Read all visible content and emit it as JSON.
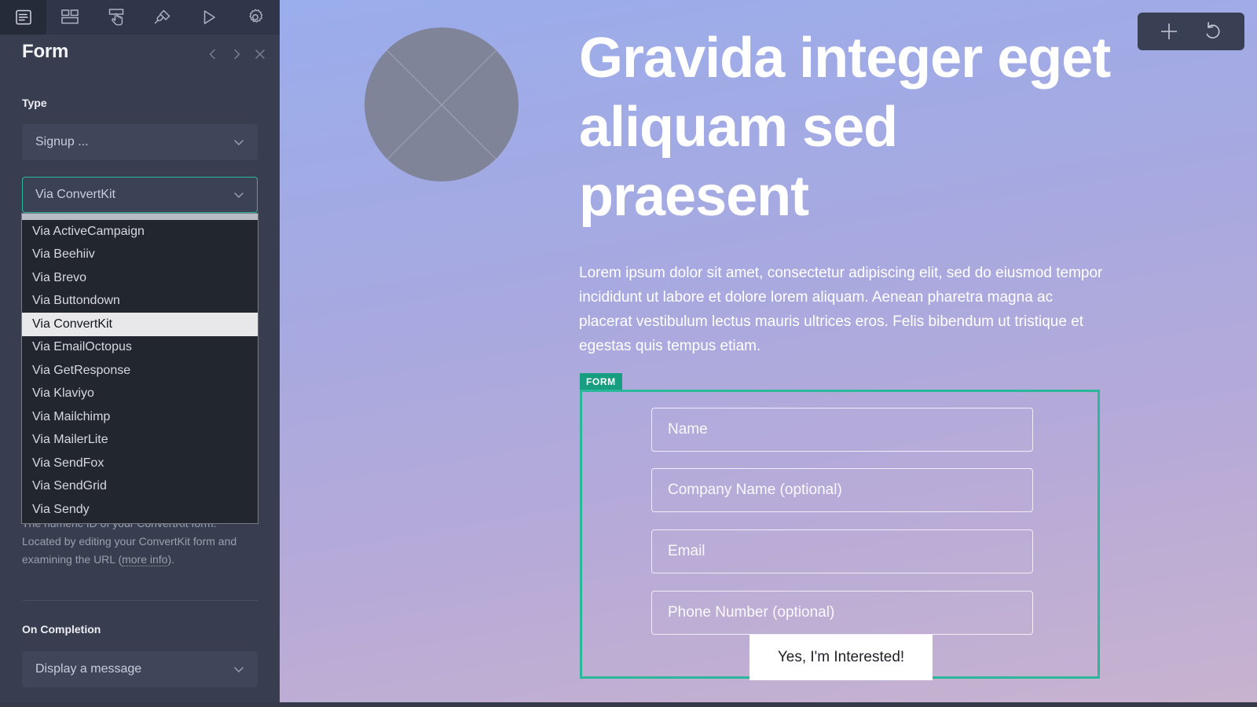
{
  "toolbar": {
    "items": [
      {
        "name": "pages-icon",
        "label": "Pages",
        "active": true
      },
      {
        "name": "layout-icon",
        "label": "Layout",
        "active": false
      },
      {
        "name": "interact-icon",
        "label": "Interactions",
        "active": false
      },
      {
        "name": "paintbrush-icon",
        "label": "Style",
        "active": false
      },
      {
        "name": "play-icon",
        "label": "Preview",
        "active": false
      },
      {
        "name": "gear-icon",
        "label": "Settings",
        "active": false
      }
    ]
  },
  "panel": {
    "title": "Form",
    "prev_label": "Previous",
    "next_label": "Next",
    "close_label": "Close"
  },
  "type_section": {
    "label": "Type",
    "form_type_value": "Signup ...",
    "provider_value": "Via ConvertKit",
    "provider_options": [
      "Via ActiveCampaign",
      "Via Beehiiv",
      "Via Brevo",
      "Via Buttondown",
      "Via ConvertKit",
      "Via EmailOctopus",
      "Via GetResponse",
      "Via Klaviyo",
      "Via Mailchimp",
      "Via MailerLite",
      "Via SendFox",
      "Via SendGrid",
      "Via Sendy"
    ],
    "selected_option": "Via ConvertKit"
  },
  "hint": {
    "text_line1": "The numeric ID of your ConvertKit form. Located by",
    "text_line2": "editing your ConvertKit form and examining the",
    "text_line3_prefix": "URL (",
    "text_link": "more info",
    "text_line3_suffix": ")."
  },
  "completion_section": {
    "label": "On Completion",
    "value": "Display a message"
  },
  "canvas": {
    "headline": "Gravida integer eget aliquam sed praesent",
    "body": "Lorem ipsum dolor sit amet, consectetur adipiscing elit, sed do eiusmod tempor incididunt ut labore et dolore lorem aliquam. Aenean pharetra magna ac placerat vestibulum lectus mauris ultrices eros. Felis bibendum ut tristique et egestas quis tempus etiam.",
    "selection_badge": "FORM",
    "accent_color": "#2bb89a",
    "badge_color": "#179e80",
    "fields": [
      {
        "placeholder": "Name",
        "name": "name-field"
      },
      {
        "placeholder": "Company Name (optional)",
        "name": "company-field"
      },
      {
        "placeholder": "Email",
        "name": "email-field"
      },
      {
        "placeholder": "Phone Number (optional)",
        "name": "phone-field"
      }
    ],
    "submit_label": "Yes, I'm Interested!"
  },
  "float_controls": {
    "add_label": "Add",
    "undo_label": "Undo"
  }
}
